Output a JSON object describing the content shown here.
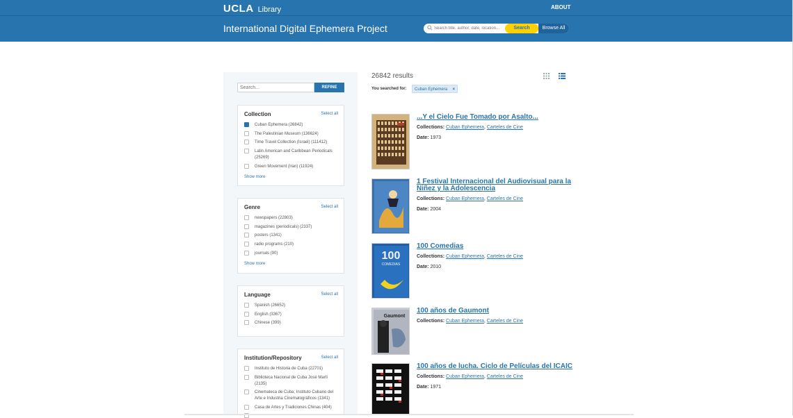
{
  "header": {
    "logo_ucla": "UCLA",
    "logo_library": "Library",
    "about": "ABOUT",
    "site_title": "International Digital Ephemera Project",
    "search_placeholder": "Search title, author, date, location...",
    "search_button": "Search",
    "browse_button": "Browse All",
    "brand_color": "#2774ae",
    "accent_color": "#ffd100"
  },
  "sidebar": {
    "search_placeholder": "Search...",
    "refine_button": "REFINE",
    "select_all": "Select all",
    "show_more": "Show more",
    "facets": [
      {
        "title": "Collection",
        "items": [
          {
            "label": "Cuban Ephemera (26842)",
            "checked": true
          },
          {
            "label": "The Palestinian Museum (136624)",
            "checked": false
          },
          {
            "label": "Time Travel Collection (Israel) (111412)",
            "checked": false
          },
          {
            "label": "Latin American and Caribbean Periodicals (25269)",
            "checked": false
          },
          {
            "label": "Green Movement (Iran) (11924)",
            "checked": false
          }
        ]
      },
      {
        "title": "Genre",
        "items": [
          {
            "label": "newspapers (22803)",
            "checked": false
          },
          {
            "label": "magazines (periodicals) (2337)",
            "checked": false
          },
          {
            "label": "posters (1341)",
            "checked": false
          },
          {
            "label": "radio programs (210)",
            "checked": false
          },
          {
            "label": "journals (90)",
            "checked": false
          }
        ]
      },
      {
        "title": "Language",
        "items": [
          {
            "label": "Spanish (26652)",
            "checked": false
          },
          {
            "label": "English (3367)",
            "checked": false
          },
          {
            "label": "Chinese (399)",
            "checked": false
          }
        ]
      },
      {
        "title": "Institution/Repository",
        "items": [
          {
            "label": "Instituto de Historia de Cuba (22701)",
            "checked": false
          },
          {
            "label": "Biblioteca Nacional de Cuba José Martí (2135)",
            "checked": false
          },
          {
            "label": "Cinemateca de Cuba; Instituto Cubano del Arte e Industria Cinematográficos (1341)",
            "checked": false
          },
          {
            "label": "Casa de Artes y Tradiciones Chinas (404)",
            "checked": false
          },
          {
            "label": "",
            "checked": false
          }
        ]
      }
    ]
  },
  "results": {
    "count": "26842 results",
    "searched_for": "You searched for:",
    "filter_tag": "Cuban Ephemera",
    "filter_remove": "×",
    "collections_label": "Collections:",
    "date_label": "Date:",
    "items": [
      {
        "title": "...Y el Cielo Fue Tomado por Asalto...",
        "collection1": "Cuban Ephemera",
        "collection2": "Carteles de Cine",
        "date": "1973"
      },
      {
        "title": "1 Festival Internacional del Audiovisual para la Niñez y la Adolescencia",
        "collection1": "Cuban Ephemera",
        "collection2": "Carteles de Cine",
        "date": "2004"
      },
      {
        "title": "100 Comedias",
        "collection1": "Cuban Ephemera",
        "collection2": "Carteles de Cine",
        "date": "2010"
      },
      {
        "title": "100 años de Gaumont",
        "collection1": "Cuban Ephemera",
        "collection2": "Carteles de Cine",
        "date": ""
      },
      {
        "title": "100 años de lucha. Ciclo de Películas del ICAIC",
        "collection1": "Cuban Ephemera",
        "collection2": "Carteles de Cine",
        "date": "1971"
      }
    ],
    "thumb_text": {
      "comedias": "100",
      "comedias_sub": "COMEDIAS",
      "gaumont": "Gaumont"
    }
  }
}
